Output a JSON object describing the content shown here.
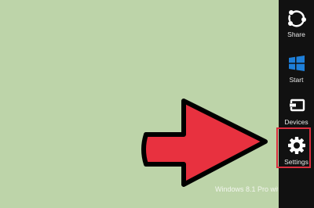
{
  "charms": {
    "share": {
      "label": "Share",
      "icon": "share-icon"
    },
    "start": {
      "label": "Start",
      "icon": "windows-logo-icon",
      "color": "#1e7fd9"
    },
    "devices": {
      "label": "Devices",
      "icon": "devices-icon"
    },
    "settings": {
      "label": "Settings",
      "icon": "gear-icon"
    }
  },
  "desktop": {
    "watermark": "Windows 8.1 Pro with M"
  },
  "colors": {
    "desktop_background": "#bdd4a9",
    "charm_bar": "#111111",
    "annotation_arrow": "#e8313f",
    "highlight_box": "#d92e3e"
  }
}
